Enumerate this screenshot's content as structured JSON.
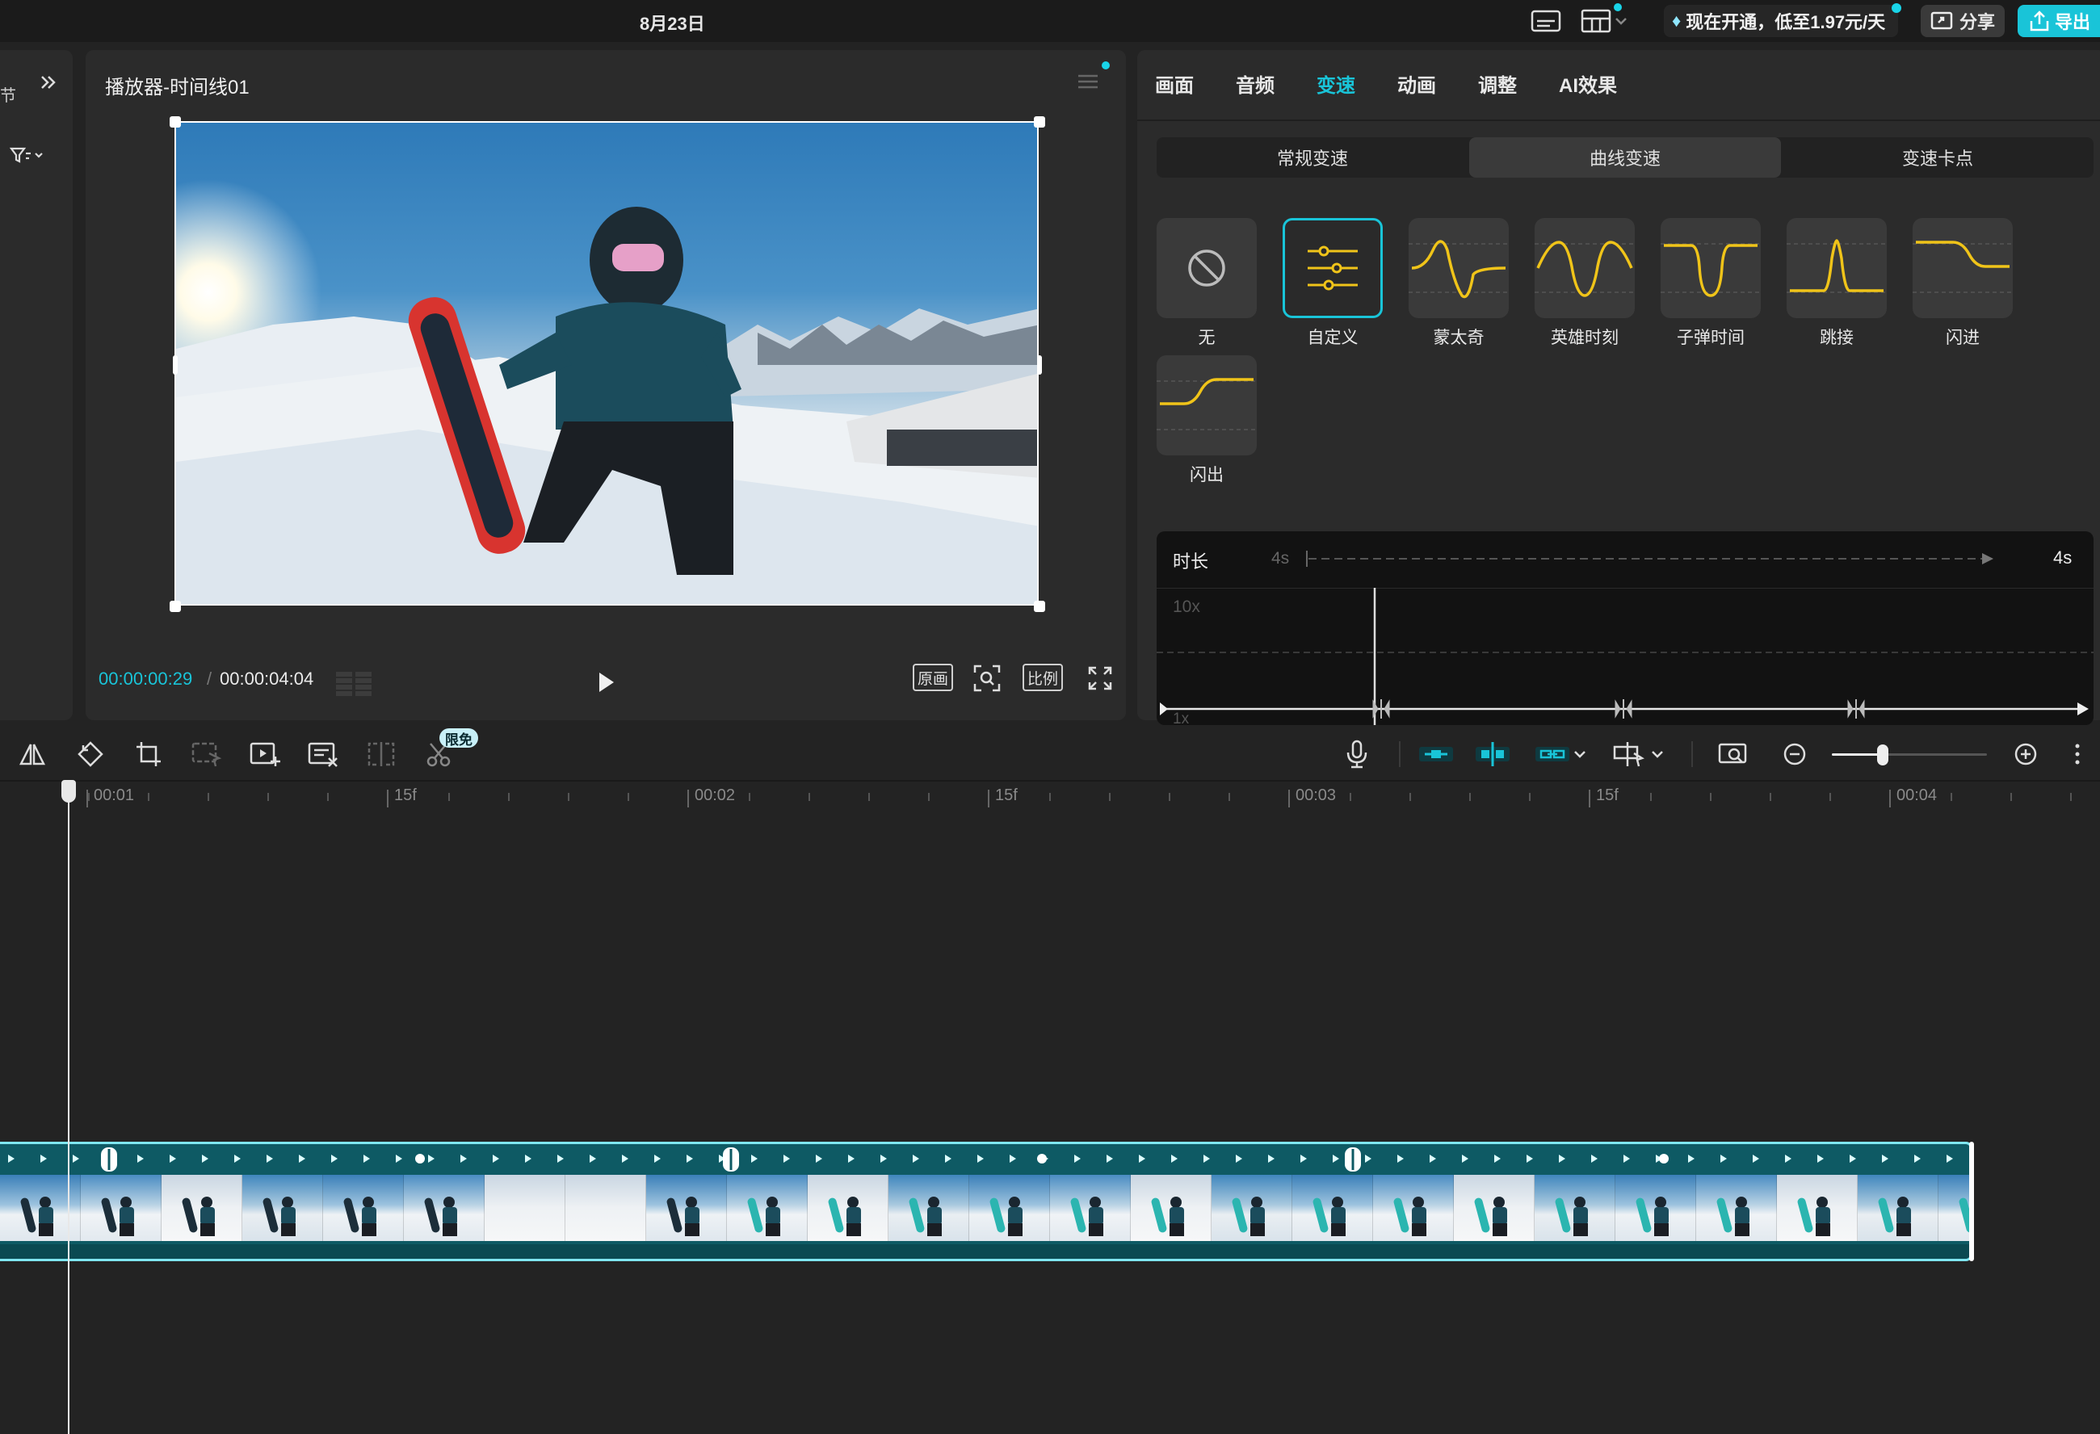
{
  "topbar": {
    "date": "8月23日",
    "promo": "现在开通，低至1.97元/天",
    "share": "分享",
    "export": "导出"
  },
  "left_panel": {
    "label": "节"
  },
  "player": {
    "title": "播放器-时间线01",
    "current_time": "00:00:00:29",
    "separator": "/",
    "total_time": "00:00:04:04",
    "btn_original": "原画",
    "btn_ratio": "比例"
  },
  "props": {
    "tabs": [
      "画面",
      "音频",
      "变速",
      "动画",
      "调整",
      "AI效果"
    ],
    "active_tab": "变速",
    "subtabs": [
      "常规变速",
      "曲线变速",
      "变速卡点"
    ],
    "active_subtab": "曲线变速",
    "presets": [
      {
        "label": "无",
        "icon": "none-icon"
      },
      {
        "label": "自定义",
        "icon": "custom-sliders-icon"
      },
      {
        "label": "蒙太奇",
        "icon": "montage-curve-icon"
      },
      {
        "label": "英雄时刻",
        "icon": "hero-moment-curve-icon"
      },
      {
        "label": "子弹时间",
        "icon": "bullet-time-curve-icon"
      },
      {
        "label": "跳接",
        "icon": "jump-cut-curve-icon"
      },
      {
        "label": "闪进",
        "icon": "flash-in-curve-icon"
      },
      {
        "label": "闪出",
        "icon": "flash-out-curve-icon"
      }
    ],
    "selected_preset": "自定义",
    "curve": {
      "duration_label": "时长",
      "duration_from": "4s",
      "duration_to": "4s",
      "y_top": "10x",
      "y_bottom": "1x"
    }
  },
  "toolbar": {
    "free_badge": "限免"
  },
  "ruler": {
    "labels": [
      "00:01",
      "15f",
      "00:02",
      "15f",
      "00:03",
      "15f",
      "00:04"
    ]
  },
  "colors": {
    "accent": "#19c4d8",
    "curve_yellow": "#f0c419",
    "clip_bg": "#0e5a64"
  }
}
